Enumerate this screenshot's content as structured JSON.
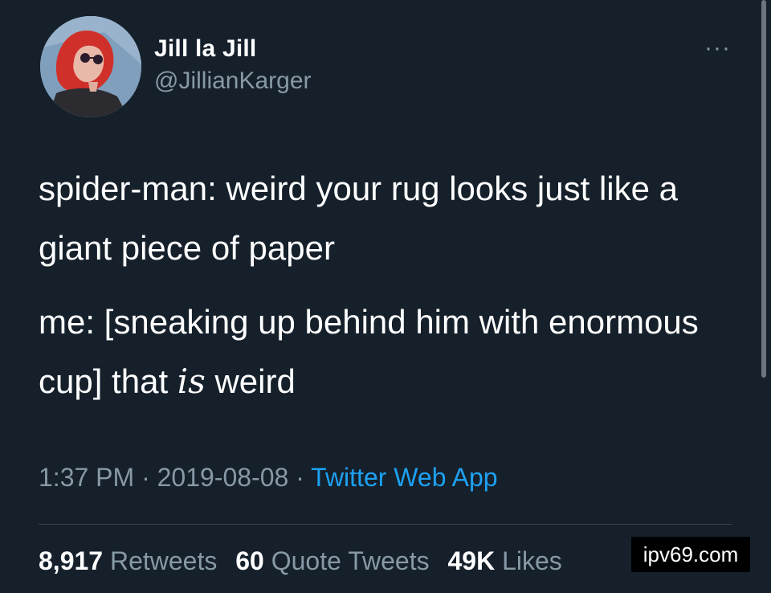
{
  "tweet": {
    "author": {
      "display_name": "Jill la Jill",
      "handle": "@JillianKarger"
    },
    "more_icon": "more-horizontal-icon",
    "text": {
      "p1": "spider-man: weird your rug looks just like a giant piece of paper",
      "p2_before": "me: [sneaking up behind him with enormous cup] that ",
      "p2_emph": "is",
      "p2_after": " weird"
    },
    "meta": {
      "time": "1:37 PM",
      "sep1": " · ",
      "date": "2019-08-08",
      "sep2": " · ",
      "source": "Twitter Web App"
    },
    "stats": {
      "retweets_count": "8,917",
      "retweets_label": "Retweets",
      "quotes_count": "60",
      "quotes_label": "Quote Tweets",
      "likes_count": "49K",
      "likes_label": "Likes"
    }
  },
  "watermark": "ipv69.com",
  "colors": {
    "background": "#15202b",
    "secondary_text": "#8899a6",
    "link": "#1da1f2"
  }
}
